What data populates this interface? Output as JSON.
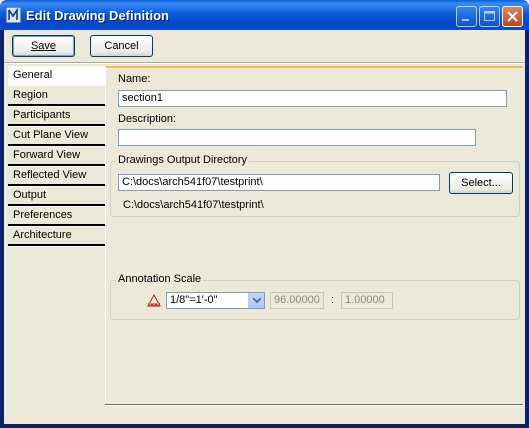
{
  "window": {
    "title": "Edit Drawing Definition"
  },
  "toolbar": {
    "save_label": "Save",
    "cancel_label": "Cancel"
  },
  "tabs": [
    {
      "label": "General"
    },
    {
      "label": "Region"
    },
    {
      "label": "Participants"
    },
    {
      "label": "Cut Plane View"
    },
    {
      "label": "Forward View"
    },
    {
      "label": "Reflected View"
    },
    {
      "label": "Output"
    },
    {
      "label": "Preferences"
    },
    {
      "label": "Architecture"
    }
  ],
  "general": {
    "name_label": "Name:",
    "name_value": "section1",
    "description_label": "Description:",
    "description_value": "",
    "output_dir_group": "Drawings Output Directory",
    "output_dir_value": "C:\\docs\\arch541f07\\testprint\\",
    "select_label": "Select...",
    "output_dir_resolved": "C:\\docs\\arch541f07\\testprint\\",
    "annotation_group": "Annotation Scale",
    "scale_selected": "1/8\"=1'-0\"",
    "scale_left": "96.00000",
    "scale_sep": ":",
    "scale_right": "1.00000"
  },
  "colors": {
    "titlebar": "#0b5bd9",
    "tab_highlight": "#f0c060"
  }
}
